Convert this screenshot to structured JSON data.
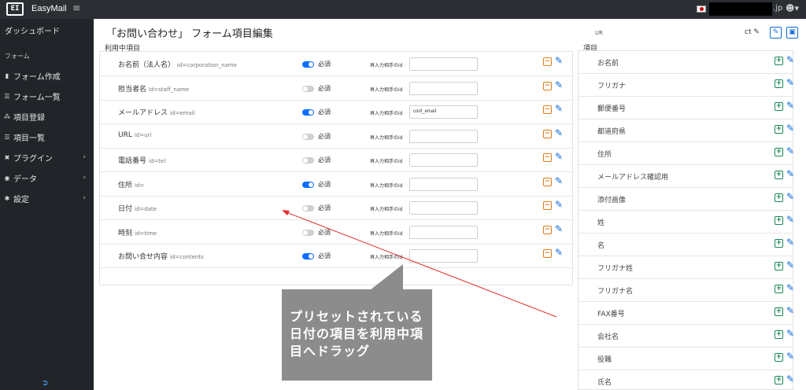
{
  "topbar": {
    "logo": "EI",
    "brand": "EasyMail",
    "menu_icon": "hamburger-icon",
    "domain_suffix": ".jp",
    "user_icon": "user-icon"
  },
  "sidebar": {
    "dashboard": "ダッシュボード",
    "section_form": "フォーム",
    "items": [
      {
        "label": "フォーム作成",
        "icon": "document-icon",
        "chevron": ""
      },
      {
        "label": "フォーム一覧",
        "icon": "list-icon",
        "chevron": ""
      },
      {
        "label": "項目登録",
        "icon": "cubes-icon",
        "chevron": ""
      },
      {
        "label": "項目一覧",
        "icon": "list-icon",
        "chevron": ""
      },
      {
        "label": "プラグイン",
        "icon": "plugin-icon",
        "chevron": "›"
      },
      {
        "label": "データ",
        "icon": "database-icon",
        "chevron": "›"
      },
      {
        "label": "設定",
        "icon": "gear-icon",
        "chevron": "›"
      }
    ]
  },
  "main": {
    "title": "「お問い合わせ」 フォーム項目編集",
    "used_items_label": "利用中項目",
    "items_label": "項目",
    "ur_label": "UR",
    "ct_label": "ct",
    "required_label": "必須",
    "reenter_label": "再入力相手のid",
    "used_items": [
      {
        "name": "お名前（法人名）",
        "id": "id=corporation_name",
        "required": true,
        "reenter": ""
      },
      {
        "name": "担当者名",
        "id": "id=staff_name",
        "required": false,
        "reenter": ""
      },
      {
        "name": "メールアドレス",
        "id": "id=email",
        "required": true,
        "reenter": "conf_email"
      },
      {
        "name": "URL",
        "id": "id=url",
        "required": false,
        "reenter": ""
      },
      {
        "name": "電話番号",
        "id": "id=tel",
        "required": false,
        "reenter": ""
      },
      {
        "name": "住所",
        "id": "id=",
        "required": true,
        "reenter": ""
      },
      {
        "name": "日付",
        "id": "id=date",
        "required": false,
        "reenter": ""
      },
      {
        "name": "時刻",
        "id": "id=time",
        "required": false,
        "reenter": ""
      },
      {
        "name": "お問い合せ内容",
        "id": "id=contents",
        "required": true,
        "reenter": ""
      }
    ],
    "available_items": [
      "お名前",
      "フリガナ",
      "郵便番号",
      "都道府県",
      "住所",
      "メールアドレス確認用",
      "添付画像",
      "姓",
      "名",
      "フリガナ姓",
      "フリガナ名",
      "FAX番号",
      "会社名",
      "役職",
      "氏名"
    ]
  },
  "annotation": {
    "text": "プリセットされている日付の項目を利用中項目へドラッグ",
    "box_color": "#8c8c8c",
    "arrow_color": "#e03030"
  }
}
